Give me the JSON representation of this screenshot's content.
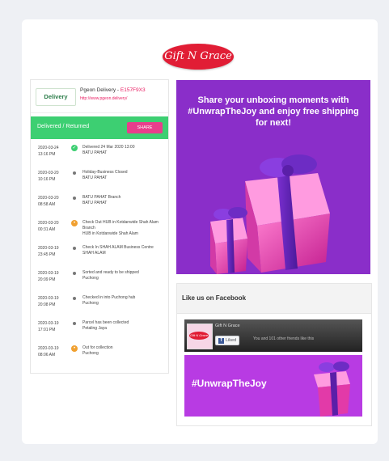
{
  "brand": {
    "logo_text": "Gift N Grace"
  },
  "tracking": {
    "courier_logo": "Delivery",
    "courier_name": "Pgeon Delivery -",
    "tracking_no": "E157F9X3",
    "courier_url": "http://www.pgeon.delivery/",
    "status": "Delivered / Returned",
    "share_label": "SHARE",
    "events": [
      {
        "time": "2020-03-24\n13:16 PM",
        "icon": "check-icon",
        "text": "Delivered 24 Mar 2020 13:00\nBATU PAHAT"
      },
      {
        "time": "2020-03-20\n10:16 PM",
        "icon": "dot-icon",
        "text": "Holiday-Business Closed\nBATU PAHAT"
      },
      {
        "time": "2020-03-20\n08:58 AM",
        "icon": "dot-icon",
        "text": "BATU PAHAT Branch\nBATU PAHAT"
      },
      {
        "time": "2020-03-20\n00:31 AM",
        "icon": "truck-icon",
        "text": "Check Out HUB in Kotdanwide Shah Alam Branch\nHUB in Kotdanwide Shah Alam"
      },
      {
        "time": "2020-03-19\n23:45 PM",
        "icon": "dot-icon",
        "text": "Check In SHAH ALAM Business Centre\nSHAH ALAM"
      },
      {
        "time": "2020-03-19\n20:09 PM",
        "icon": "dot-icon",
        "text": "Sorted and ready to be shipped\nPuchong"
      },
      {
        "time": "2020-03-19\n20:08 PM",
        "icon": "dot-icon",
        "text": "Checked in into Puchong hub\nPuchong"
      },
      {
        "time": "2020-03-19\n17:01 PM",
        "icon": "dot-icon",
        "text": "Parcel has been collected\nPetaling Jaya"
      },
      {
        "time": "2020-03-19\n08:06 AM",
        "icon": "truck-icon",
        "text": "Out for collection\nPuchong"
      }
    ]
  },
  "promo": {
    "headline": "Share your unboxing moments with #UnwrapTheJoy and enjoy free shipping for next!"
  },
  "facebook": {
    "title": "Like us on Facebook",
    "page_name": "Gift N Grace",
    "like_label": "Liked",
    "friends_text": "You and 101 other friends like this",
    "hashtag": "#UnwrapTheJoy"
  },
  "colors": {
    "brand_red": "#e11d35",
    "status_green": "#3dcf72",
    "share_pink": "#e83e8c",
    "promo_purple": "#8a2ec9"
  }
}
